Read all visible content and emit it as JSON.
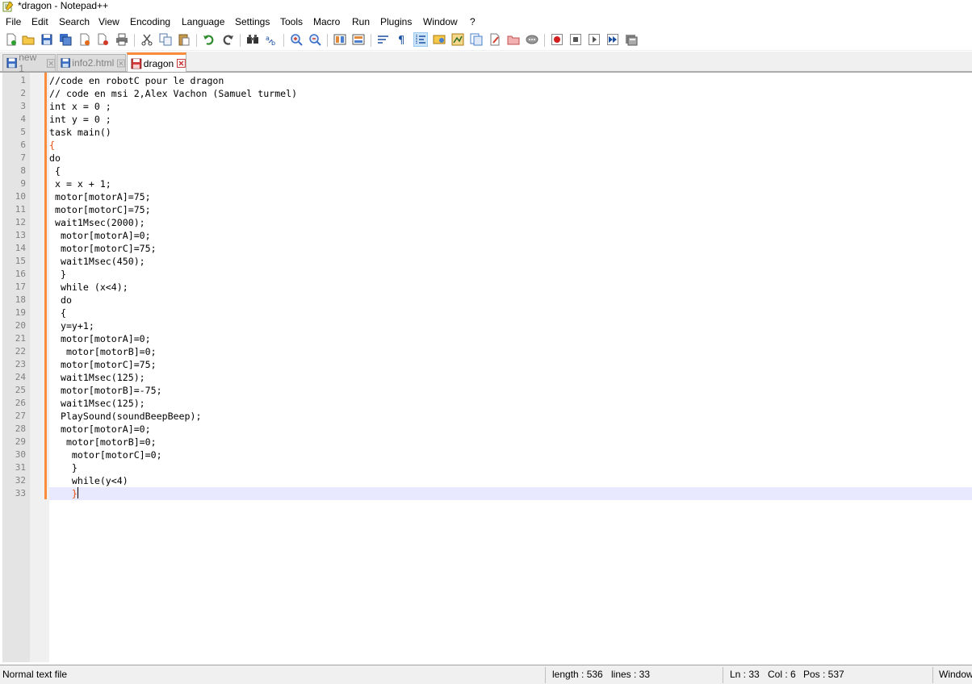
{
  "window": {
    "title": "*dragon - Notepad++"
  },
  "menu": [
    "File",
    "Edit",
    "Search",
    "View",
    "Encoding",
    "Language",
    "Settings",
    "Tools",
    "Macro",
    "Run",
    "Plugins",
    "Window",
    "?"
  ],
  "toolbar": [
    {
      "icon": "new-file-icon"
    },
    {
      "icon": "open-file-icon"
    },
    {
      "icon": "save-icon"
    },
    {
      "icon": "save-all-icon"
    },
    {
      "icon": "close-icon"
    },
    {
      "icon": "close-all-icon"
    },
    {
      "icon": "print-icon"
    },
    {
      "icon": "cut-icon"
    },
    {
      "icon": "copy-icon"
    },
    {
      "icon": "paste-icon"
    },
    {
      "icon": "undo-icon"
    },
    {
      "icon": "redo-icon"
    },
    {
      "icon": "find-icon"
    },
    {
      "icon": "replace-icon"
    },
    {
      "icon": "zoom-in-icon"
    },
    {
      "icon": "zoom-out-icon"
    },
    {
      "icon": "sync-vertical-icon"
    },
    {
      "icon": "sync-horizontal-icon"
    },
    {
      "icon": "word-wrap-icon"
    },
    {
      "icon": "show-all-characters-icon"
    },
    {
      "icon": "indent-guide-icon"
    },
    {
      "icon": "user-language-icon"
    },
    {
      "icon": "document-map-icon"
    },
    {
      "icon": "function-list-icon"
    },
    {
      "icon": "folder-workspace-icon"
    },
    {
      "icon": "monitoring-icon"
    },
    {
      "icon": "folder-icon"
    },
    {
      "icon": "record-icon"
    },
    {
      "icon": "macro-record-icon"
    },
    {
      "icon": "macro-stop-icon"
    },
    {
      "icon": "macro-play-icon"
    },
    {
      "icon": "macro-run-multiple-icon"
    },
    {
      "icon": "macro-save-icon"
    }
  ],
  "tabs": [
    {
      "label": "new 1",
      "active": false
    },
    {
      "label": "info2.html",
      "active": false
    },
    {
      "label": "dragon",
      "active": true
    }
  ],
  "editor": {
    "lines": [
      "//code en robotC pour le dragon",
      "// code en msi 2,Alex Vachon (Samuel turmel)",
      "int x = 0 ;",
      "int y = 0 ;",
      "task main()",
      "{",
      "do",
      " {",
      " x = x + 1;",
      " motor[motorA]=75;",
      " motor[motorC]=75;",
      " wait1Msec(2000);",
      "  motor[motorA]=0;",
      "  motor[motorC]=75;",
      "  wait1Msec(450);",
      "  }",
      "  while (x<4);",
      "  do",
      "  {",
      "  y=y+1;",
      "  motor[motorA]=0;",
      "   motor[motorB]=0;",
      "  motor[motorC]=75;",
      "  wait1Msec(125);",
      "  motor[motorB]=-75;",
      "  wait1Msec(125);",
      "  PlaySound(soundBeepBeep);",
      "  motor[motorA]=0;",
      "   motor[motorB]=0;",
      "    motor[motorC]=0;",
      "    }",
      "    while(y<4)",
      "    }"
    ]
  },
  "status": {
    "file_type": "Normal text file",
    "length": "length : 536",
    "lines": "lines : 33",
    "ln": "Ln : 33",
    "col": "Col : 6",
    "pos": "Pos : 537",
    "eol": "Windows (CR LF)"
  }
}
